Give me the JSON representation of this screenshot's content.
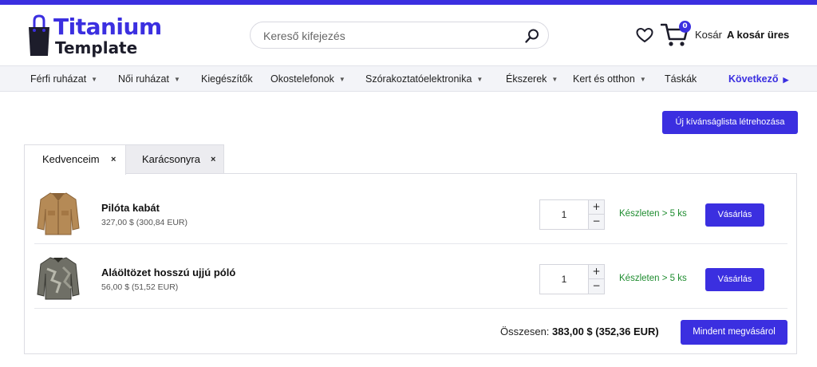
{
  "brand": {
    "title": "Titanium",
    "subtitle": "Template",
    "accent": "#3b2fe0"
  },
  "search": {
    "placeholder": "Kereső kifejezés",
    "value": "",
    "icon": "search-icon"
  },
  "header": {
    "wishlist_icon": "heart-icon",
    "cart_icon": "cart-icon",
    "cart_count": "0",
    "cart_label": "Kosár",
    "cart_status": "A kosár üres"
  },
  "nav": {
    "items": [
      {
        "label": "Férfi ruházat",
        "has_dropdown": true
      },
      {
        "label": "Női ruházat",
        "has_dropdown": true
      },
      {
        "label": "Kiegészítők",
        "has_dropdown": false
      },
      {
        "label": "Okostelefonok",
        "has_dropdown": true
      },
      {
        "label": "Szórakoztatóelektronika",
        "has_dropdown": true
      },
      {
        "label": "Ékszerek",
        "has_dropdown": true
      },
      {
        "label": "Kert és otthon",
        "has_dropdown": true
      },
      {
        "label": "Táskák",
        "has_dropdown": false
      }
    ],
    "next_label": "Következő"
  },
  "wishlist": {
    "create_label": "Új kívánságlista létrehozása",
    "tabs": [
      {
        "label": "Kedvenceim",
        "active": true,
        "close": "×"
      },
      {
        "label": "Karácsonyra",
        "active": false,
        "close": "×"
      }
    ],
    "items": [
      {
        "name": "Pilóta kabát",
        "price": "327,00 $ (300,84 EUR)",
        "qty": "1",
        "stock": "Készleten > 5 ks",
        "buy_label": "Vásárlás",
        "image": "jacket-image"
      },
      {
        "name": "Aláöltözet hosszú ujjú póló",
        "price": "56,00 $ (51,52 EUR)",
        "qty": "1",
        "stock": "Készleten > 5 ks",
        "buy_label": "Vásárlás",
        "image": "shirt-image"
      }
    ],
    "qty_plus": "+",
    "qty_minus": "−",
    "total_label": "Összesen:",
    "total_value": "383,00 $ (352,36 EUR)",
    "buy_all_label": "Mindent megvásárol"
  },
  "colors": {
    "accent": "#3b2fe0",
    "stock_green": "#1e8c2f",
    "nav_bg": "#f3f4f8"
  }
}
